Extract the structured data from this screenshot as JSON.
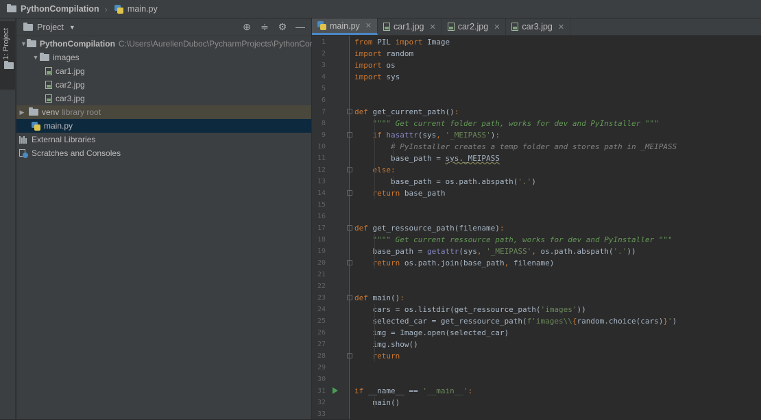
{
  "breadcrumb": {
    "project": "PythonCompilation",
    "file": "main.py"
  },
  "toolstrip": {
    "project_tab": "1: Project"
  },
  "project_panel": {
    "title": "Project",
    "tree": {
      "root_name": "PythonCompilation",
      "root_path": "C:\\Users\\AurelienDuboc\\PycharmProjects\\PythonCompil",
      "images_folder": "images",
      "images": [
        "car1.jpg",
        "car2.jpg",
        "car3.jpg"
      ],
      "venv_name": "venv",
      "venv_hint": "library root",
      "main_file": "main.py",
      "external_libraries": "External Libraries",
      "scratches": "Scratches and Consoles"
    }
  },
  "editor": {
    "tabs": [
      {
        "label": "main.py",
        "icon": "python-file-icon",
        "active": true
      },
      {
        "label": "car1.jpg",
        "icon": "image-file-icon",
        "active": false
      },
      {
        "label": "car2.jpg",
        "icon": "image-file-icon",
        "active": false
      },
      {
        "label": "car3.jpg",
        "icon": "image-file-icon",
        "active": false
      }
    ],
    "close_glyph": "✕",
    "code_lines": [
      "from PIL import Image",
      "import random",
      "import os",
      "import sys",
      "",
      "",
      "def get_current_path():",
      "    \"\"\"\" Get current folder path, works for dev and PyInstaller \"\"\"",
      "    if hasattr(sys, '_MEIPASS'):",
      "        # PyInstaller creates a temp folder and stores path in _MEIPASS",
      "        base_path = sys._MEIPASS",
      "    else:",
      "        base_path = os.path.abspath('.')",
      "    return base_path",
      "",
      "",
      "def get_ressource_path(filename):",
      "    \"\"\"\" Get current ressource path, works for dev and PyInstaller \"\"\"",
      "    base_path = getattr(sys, '_MEIPASS', os.path.abspath('.'))",
      "    return os.path.join(base_path, filename)",
      "",
      "",
      "def main():",
      "    cars = os.listdir(get_ressource_path('images'))",
      "    selected_car = get_ressource_path(f'images\\\\{random.choice(cars)}')",
      "    img = Image.open(selected_car)",
      "    img.show()",
      "    return",
      "",
      "",
      "if __name__ == '__main__':",
      "    main()",
      ""
    ]
  }
}
